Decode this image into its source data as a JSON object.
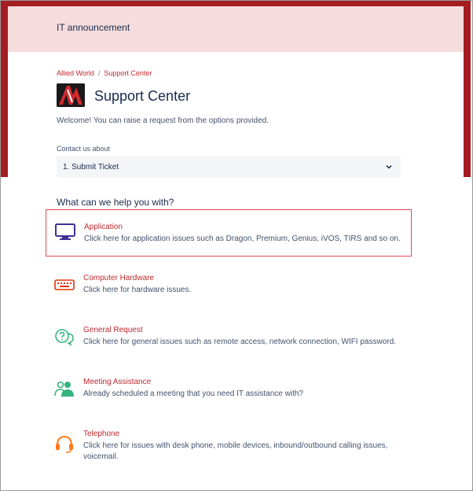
{
  "announcement": "IT announcement",
  "breadcrumb": {
    "root": "Allied World",
    "separator": "/",
    "current": "Support Center"
  },
  "header": {
    "title": "Support Center",
    "welcome": "Welcome! You can raise a request from the options provided."
  },
  "contact": {
    "label": "Contact us about",
    "selected": "1. Submit Ticket"
  },
  "help_heading": "What can we help you with?",
  "options": [
    {
      "name": "Application",
      "desc": "Click here for application issues such as Dragon, Premium, Genius, iVOS, TIRS and so on.",
      "icon": "monitor-icon"
    },
    {
      "name": "Computer Hardware",
      "desc": "Click here for hardware issues.",
      "icon": "keyboard-icon"
    },
    {
      "name": "General Request",
      "desc": "Click here for general issues such as remote access, network connection, WIFI password.",
      "icon": "question-bubbles-icon"
    },
    {
      "name": "Meeting Assistance",
      "desc": "Already scheduled a meeting that you need IT assistance with?",
      "icon": "people-icon"
    },
    {
      "name": "Telephone",
      "desc": "Click here for issues with desk phone, mobile devices, inbound/outbound calling issues, voicemail.",
      "icon": "headset-icon"
    }
  ],
  "colors": {
    "accent": "#c0282d",
    "brand_band": "#a31d21",
    "announcement_bg": "#f6dcdc",
    "selected_border": "#e5484d"
  }
}
